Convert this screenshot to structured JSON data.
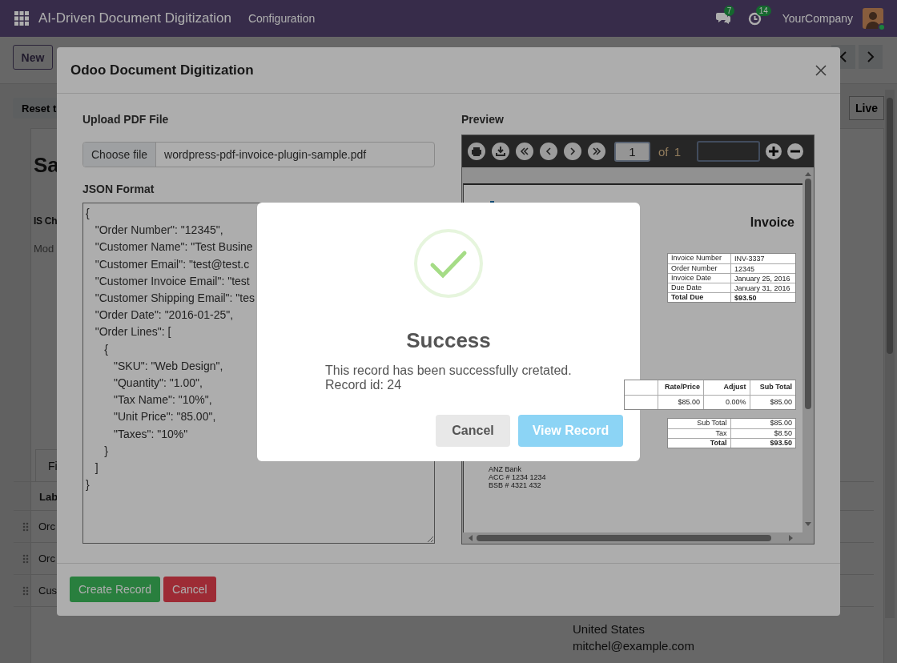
{
  "navbar": {
    "app_title": "AI-Driven Document Digitization",
    "menu": [
      "Configuration"
    ],
    "messages_badge": "7",
    "activities_badge": "14",
    "company": "YourCompany"
  },
  "background": {
    "new_button": "New",
    "reset_button": "Reset t",
    "status_button": "Live",
    "title": "Sa",
    "field_labels": [
      "IS Ch",
      "Mod"
    ],
    "tab": "Fi",
    "table_header": "Lab",
    "table_rows": [
      "Orc",
      "Orc",
      "Cus"
    ],
    "address_lines": [
      "United States",
      "mitchel@example.com"
    ]
  },
  "dialog": {
    "title": "Odoo Document Digitization",
    "upload_label": "Upload PDF File",
    "file_button": "Choose file",
    "file_name": "wordpress-pdf-invoice-plugin-sample.pdf",
    "json_label": "JSON Format",
    "json_text": "{\n   \"Order Number\": \"12345\",\n   \"Customer Name\": \"Test Busine\n   \"Customer Email\": \"test@test.c\n   \"Customer Invoice Email\": \"test\n   \"Customer Shipping Email\": \"tes\n   \"Order Date\": \"2016-01-25\",\n   \"Order Lines\": [\n      {\n         \"SKU\": \"Web Design\",\n         \"Quantity\": \"1.00\",\n         \"Tax Name\": \"10%\",\n         \"Unit Price\": \"85.00\",\n         \"Taxes\": \"10%\"\n      }\n   ]\n}",
    "preview_label": "Preview",
    "pdf_viewer": {
      "page": "1",
      "page_count": "of 1",
      "document": {
        "heading": "Invoice",
        "info_rows": [
          [
            "Invoice Number",
            "INV-3337"
          ],
          [
            "Order Number",
            "12345"
          ],
          [
            "Invoice Date",
            "January 25, 2016"
          ],
          [
            "Due Date",
            "January 31, 2016"
          ],
          [
            "Total Due",
            "$93.50"
          ]
        ],
        "item_columns": [
          "Rate/Price",
          "Adjust",
          "Sub Total"
        ],
        "item_row": [
          "$85.00",
          "0.00%",
          "$85.00"
        ],
        "totals": [
          [
            "Sub Total",
            "$85.00"
          ],
          [
            "Tax",
            "$8.50"
          ],
          [
            "Total",
            "$93.50"
          ]
        ],
        "bank_lines": [
          "ANZ Bank",
          "ACC # 1234 1234",
          "BSB # 4321 432"
        ]
      }
    },
    "buttons": [
      {
        "label": "Create Record",
        "kind": "primary"
      },
      {
        "label": "Cancel",
        "kind": "danger"
      }
    ]
  },
  "alert": {
    "title": "Success",
    "message_lines": [
      "This record has been successfully cretated.",
      "Record id: 24"
    ],
    "buttons": [
      {
        "label": "Cancel",
        "kind": "cancel"
      },
      {
        "label": "View Record",
        "kind": "confirm"
      }
    ]
  }
}
